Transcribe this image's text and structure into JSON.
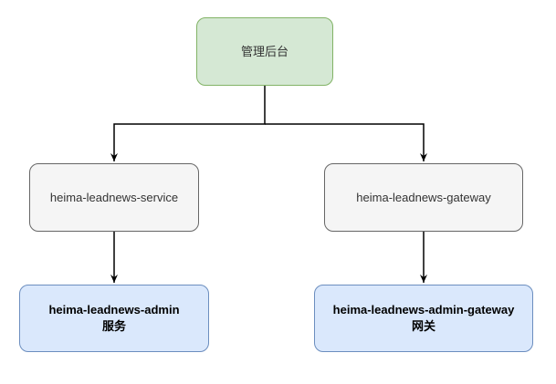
{
  "nodes": {
    "root": {
      "label": "管理后台"
    },
    "service": {
      "label": "heima-leadnews-service"
    },
    "gateway": {
      "label": "heima-leadnews-gateway"
    },
    "admin": {
      "line1": "heima-leadnews-admin",
      "line2": "服务"
    },
    "admin_gateway": {
      "line1": "heima-leadnews-admin-gateway",
      "line2": "网关"
    }
  },
  "colors": {
    "root_fill": "#d5e8d4",
    "root_stroke": "#82b366",
    "gray_fill": "#f5f5f5",
    "gray_stroke": "#666666",
    "blue_fill": "#dae8fc",
    "blue_stroke": "#6c8ebf",
    "edge": "#000000"
  }
}
